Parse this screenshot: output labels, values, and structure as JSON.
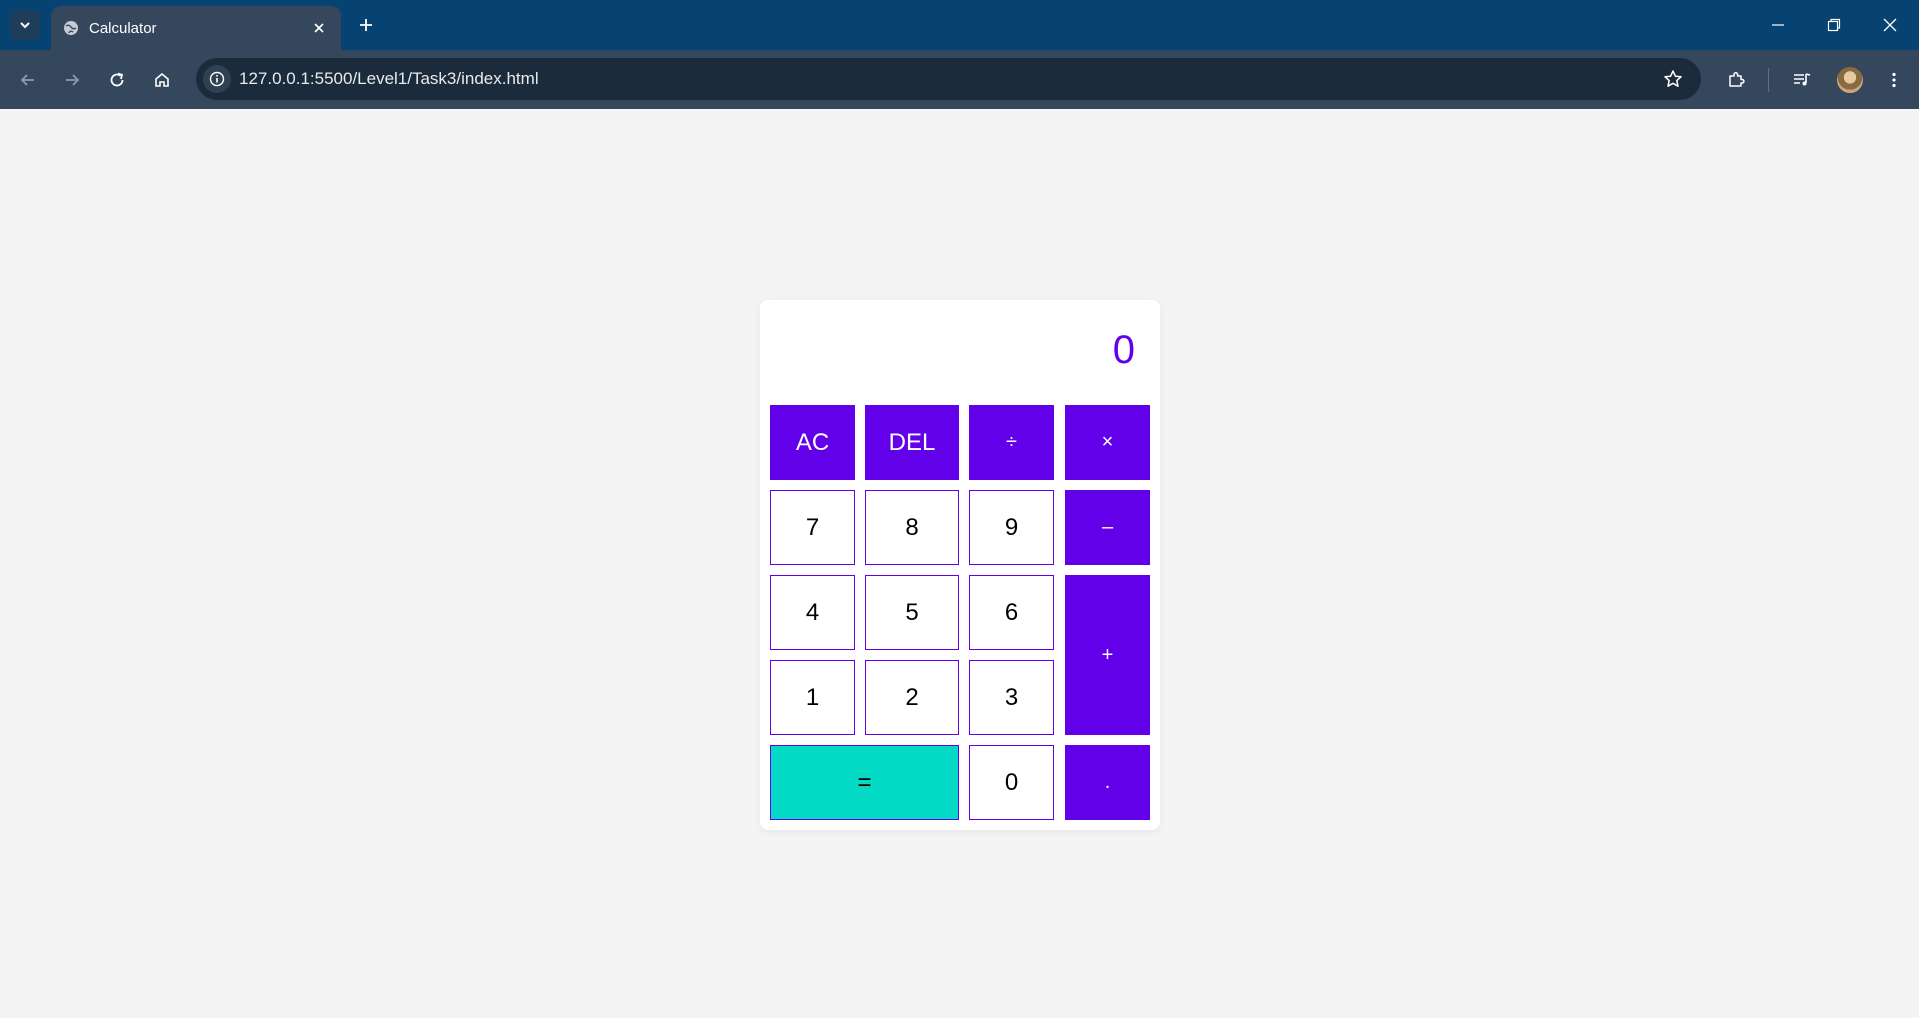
{
  "browser": {
    "tab_title": "Calculator",
    "url": "127.0.0.1:5500/Level1/Task3/index.html"
  },
  "calculator": {
    "display": "0",
    "keys": {
      "ac": "AC",
      "del": "DEL",
      "divide": "÷",
      "multiply": "×",
      "seven": "7",
      "eight": "8",
      "nine": "9",
      "minus": "–",
      "four": "4",
      "five": "5",
      "six": "6",
      "plus": "+",
      "one": "1",
      "two": "2",
      "three": "3",
      "equals": "=",
      "zero": "0",
      "decimal": "."
    },
    "colors": {
      "accent": "#6200ea",
      "equals": "#03dac6",
      "page_background": "#f4f4f4"
    }
  }
}
